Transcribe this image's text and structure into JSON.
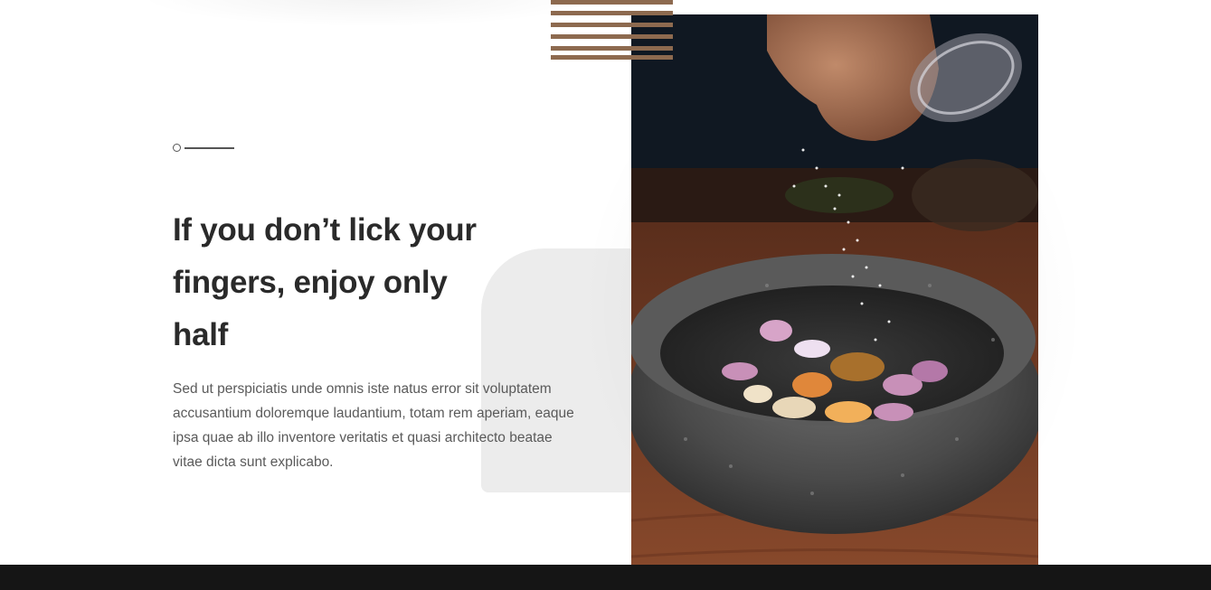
{
  "hero": {
    "headline": "If you don’t lick your fingers, enjoy only half",
    "description": "Sed ut perspiciatis unde omnis iste natus error sit voluptatem accusantium doloremque laudantium, totam rem aperiam, eaque ipsa quae ab illo inventore veritatis et quasi architecto beatae vitae dicta sunt explicabo."
  },
  "colors": {
    "accent": "#8d6a4f",
    "headline": "#2a2a2a",
    "body": "#5a5a5a",
    "footer": "#151515",
    "shape": "#ececec"
  },
  "icons": {
    "marker": "circle-line-marker-icon"
  },
  "image": {
    "subject": "hand-sprinkling-salt-into-mortar-photo"
  }
}
